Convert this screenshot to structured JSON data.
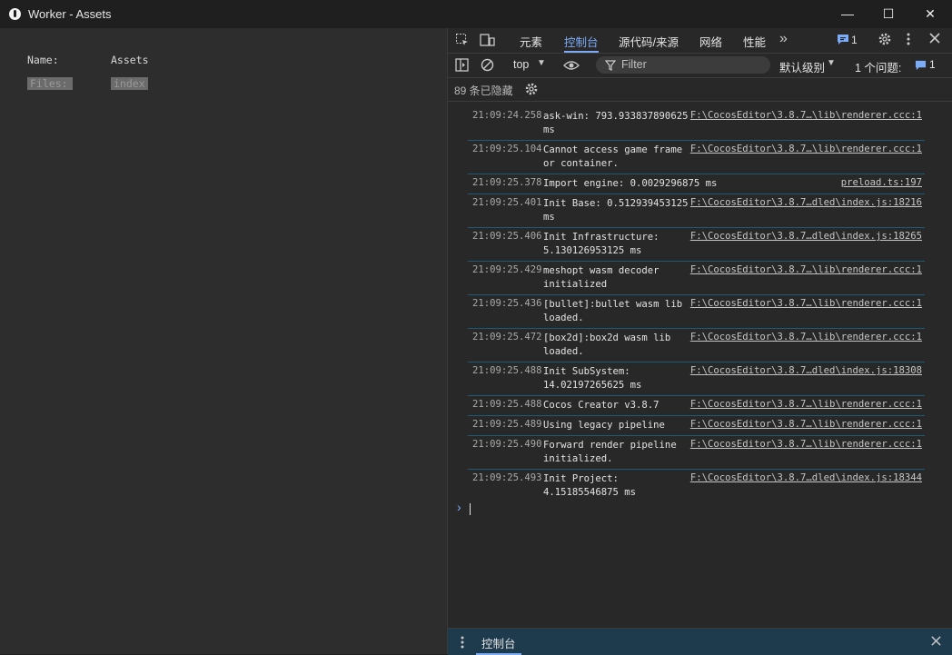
{
  "window": {
    "title": "Worker - Assets",
    "minimize": "—",
    "maximize": "☐",
    "close": "✕"
  },
  "left_pane": {
    "name_label": "Name:",
    "name_value": "Assets",
    "files_label": "Files:",
    "files_value": "index"
  },
  "devtools": {
    "tabs": [
      {
        "label": "元素"
      },
      {
        "label": "控制台"
      },
      {
        "label": "源代码/来源"
      },
      {
        "label": "网络"
      },
      {
        "label": "性能"
      }
    ],
    "more_tabs": "»",
    "issues_badge": "1",
    "toolbar": {
      "context": "top",
      "filter_placeholder": "Filter",
      "level": "默认级别",
      "issues_text": "1 个问题:",
      "issues_count": "1"
    },
    "hidden_count": "89 条已隐藏",
    "logs": [
      {
        "time": "21:09:24.258",
        "message": "ask-win: 793.933837890625 ms",
        "source": "F:\\CocosEditor\\3.8.7…\\lib\\renderer.ccc:1"
      },
      {
        "time": "21:09:25.104",
        "message": "Cannot access game frame or container.",
        "source": "F:\\CocosEditor\\3.8.7…\\lib\\renderer.ccc:1"
      },
      {
        "time": "21:09:25.378",
        "message": "Import engine: 0.0029296875 ms",
        "source": "preload.ts:197"
      },
      {
        "time": "21:09:25.401",
        "message": "Init Base: 0.512939453125 ms",
        "source": "F:\\CocosEditor\\3.8.7…dled\\index.js:18216"
      },
      {
        "time": "21:09:25.406",
        "message": "Init Infrastructure: 5.130126953125 ms",
        "source": "F:\\CocosEditor\\3.8.7…dled\\index.js:18265"
      },
      {
        "time": "21:09:25.429",
        "message": "meshopt wasm decoder initialized",
        "source": "F:\\CocosEditor\\3.8.7…\\lib\\renderer.ccc:1"
      },
      {
        "time": "21:09:25.436",
        "message": "[bullet]:bullet wasm lib loaded.",
        "source": "F:\\CocosEditor\\3.8.7…\\lib\\renderer.ccc:1"
      },
      {
        "time": "21:09:25.472",
        "message": "[box2d]:box2d wasm lib loaded.",
        "source": "F:\\CocosEditor\\3.8.7…\\lib\\renderer.ccc:1"
      },
      {
        "time": "21:09:25.488",
        "message": "Init SubSystem: 14.02197265625 ms",
        "source": "F:\\CocosEditor\\3.8.7…dled\\index.js:18308"
      },
      {
        "time": "21:09:25.488",
        "message": "Cocos Creator v3.8.7",
        "source": "F:\\CocosEditor\\3.8.7…\\lib\\renderer.ccc:1"
      },
      {
        "time": "21:09:25.489",
        "message": "Using legacy pipeline",
        "source": "F:\\CocosEditor\\3.8.7…\\lib\\renderer.ccc:1"
      },
      {
        "time": "21:09:25.490",
        "message": "Forward render pipeline initialized.",
        "source": "F:\\CocosEditor\\3.8.7…\\lib\\renderer.ccc:1"
      },
      {
        "time": "21:09:25.493",
        "message": "Init Project: 4.15185546875 ms",
        "source": "F:\\CocosEditor\\3.8.7…dled\\index.js:18344"
      }
    ],
    "prompt": "›",
    "drawer": {
      "tab": "控制台",
      "close": "✕"
    }
  },
  "colors": {
    "accent": "#7cacf8",
    "row_border": "#1e5a77",
    "drawer_bg": "#1e3a4d"
  }
}
